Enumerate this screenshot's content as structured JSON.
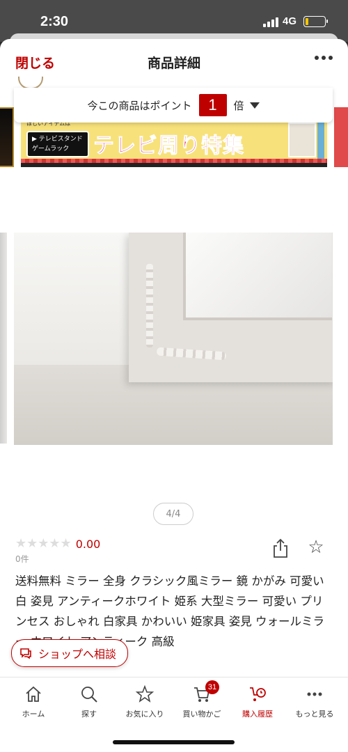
{
  "status_bar": {
    "time": "2:30",
    "network": "4G",
    "battery_level": 0.15
  },
  "header": {
    "close_label": "閉じる",
    "title": "商品詳細",
    "more_icon": "ellipsis-icon"
  },
  "points_banner": {
    "prefix": "今この商品はポイント",
    "multiplier": "1",
    "suffix": "倍"
  },
  "promo_banner": {
    "pre_text": "ほしいアイテムは",
    "badge_line1": "▶ テレビスタンド",
    "badge_line2": "ゲームラック",
    "title": "テレビ周り特集"
  },
  "gallery": {
    "pager": "4/4"
  },
  "product": {
    "rating_stars": "★★★★★",
    "rating_value": "0.00",
    "review_count": "0件",
    "title": "送料無料 ミラー 全身 クラシック風ミラー 鏡 かがみ 可愛い 白 姿見 アンティークホワイト 姫系 大型ミラー 可愛い プリンセス おしゃれ 白家具 かわいい 姫家具 姿見 ウォールミラー ホワイト アンティーク 高級"
  },
  "shop_button": {
    "label": "ショップへ相談"
  },
  "tabs": [
    {
      "label": "ホーム",
      "icon": "home-icon"
    },
    {
      "label": "探す",
      "icon": "search-icon"
    },
    {
      "label": "お気に入り",
      "icon": "star-icon"
    },
    {
      "label": "買い物かご",
      "icon": "cart-icon",
      "badge": "31"
    },
    {
      "label": "購入履歴",
      "icon": "purchase-history-icon",
      "active": true
    },
    {
      "label": "もっと見る",
      "icon": "more-icon"
    }
  ],
  "colors": {
    "accent": "#bf0000",
    "text": "#222222",
    "muted": "#999999"
  }
}
